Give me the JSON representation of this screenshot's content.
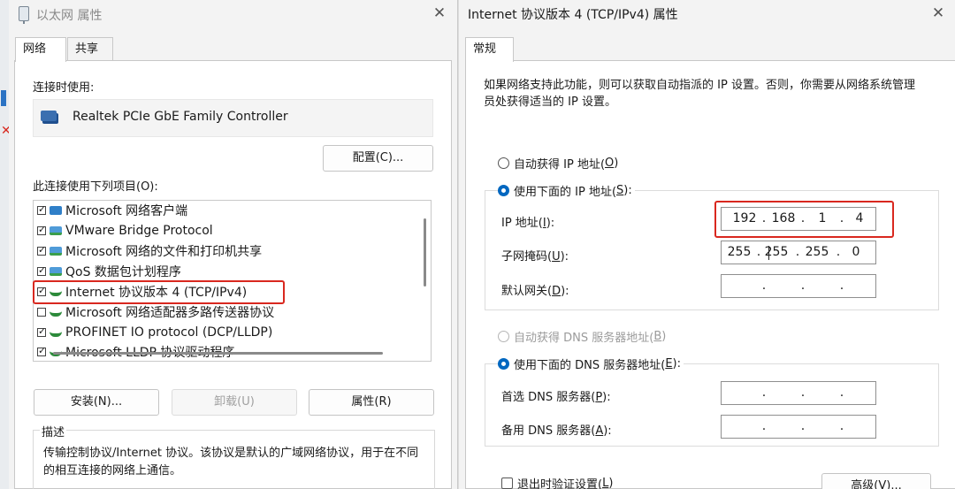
{
  "left_dialog": {
    "title": "以太网 属性",
    "close_glyph": "✕",
    "tabs": [
      {
        "label": "网络"
      },
      {
        "label": "共享"
      }
    ],
    "connect_using_label": "连接时使用:",
    "adapter_name": "Realtek PCIe GbE Family Controller",
    "configure_button": "配置(C)...",
    "items_label": "此连接使用下列项目(O):",
    "items": [
      {
        "label": "Microsoft 网络客户端",
        "checked": true,
        "icon": "network-client-icon"
      },
      {
        "label": "VMware Bridge Protocol",
        "checked": true,
        "icon": "network-service-icon"
      },
      {
        "label": "Microsoft 网络的文件和打印机共享",
        "checked": true,
        "icon": "network-service-icon"
      },
      {
        "label": "QoS 数据包计划程序",
        "checked": true,
        "icon": "network-service-icon"
      },
      {
        "label": "Internet 协议版本 4 (TCP/IPv4)",
        "checked": true,
        "icon": "network-protocol-icon"
      },
      {
        "label": "Microsoft 网络适配器多路传送器协议",
        "checked": false,
        "icon": "network-protocol-icon"
      },
      {
        "label": "PROFINET IO protocol (DCP/LLDP)",
        "checked": true,
        "icon": "network-protocol-icon"
      },
      {
        "label": "Microsoft LLDP 协议驱动程序",
        "checked": true,
        "icon": "network-protocol-icon"
      }
    ],
    "buttons": {
      "install": "安装(N)...",
      "uninstall": "卸载(U)",
      "properties": "属性(R)"
    },
    "description_legend": "描述",
    "description_text": "传输控制协议/Internet 协议。该协议是默认的广域网络协议，用于在不同的相互连接的网络上通信。"
  },
  "right_dialog": {
    "title": "Internet 协议版本 4 (TCP/IPv4) 属性",
    "close_glyph": "✕",
    "tab": "常规",
    "intro": "如果网络支持此功能，则可以获取自动指派的 IP 设置。否则，你需要从网络系统管理员处获得适当的 IP 设置。",
    "auto_ip": {
      "prefix": "自动获得 IP 地址(",
      "key": "O",
      "suffix": ")",
      "selected": false
    },
    "manual_ip": {
      "prefix": "使用下面的 IP 地址(",
      "key": "S",
      "suffix": "):",
      "selected": true
    },
    "ip_address": {
      "label_prefix": "IP 地址(",
      "key": "I",
      "label_suffix": "):",
      "octets": [
        "192",
        "168",
        "1",
        "4"
      ]
    },
    "subnet_mask": {
      "label_prefix": "子网掩码(",
      "key": "U",
      "label_suffix": "):",
      "octets": [
        "255",
        "255",
        "255",
        "0"
      ]
    },
    "gateway": {
      "label_prefix": "默认网关(",
      "key": "D",
      "label_suffix": "):",
      "octets": [
        "",
        "",
        "",
        ""
      ]
    },
    "auto_dns": {
      "prefix": "自动获得 DNS 服务器地址(",
      "key": "B",
      "suffix": ")",
      "selected": false,
      "disabled": true
    },
    "manual_dns": {
      "prefix": "使用下面的 DNS 服务器地址(",
      "key": "E",
      "suffix": "):",
      "selected": true
    },
    "preferred_dns": {
      "label_prefix": "首选 DNS 服务器(",
      "key": "P",
      "label_suffix": "):",
      "octets": [
        "",
        "",
        "",
        ""
      ]
    },
    "alternate_dns": {
      "label_prefix": "备用 DNS 服务器(",
      "key": "A",
      "label_suffix": "):",
      "octets": [
        "",
        "",
        "",
        ""
      ]
    },
    "validate_on_exit": {
      "prefix": "退出时验证设置(",
      "key": "L",
      "suffix": ")",
      "checked": false
    },
    "advanced_button": "高级(V)..."
  },
  "colors": {
    "highlight": "#d9281f",
    "accent": "#0067c0"
  }
}
